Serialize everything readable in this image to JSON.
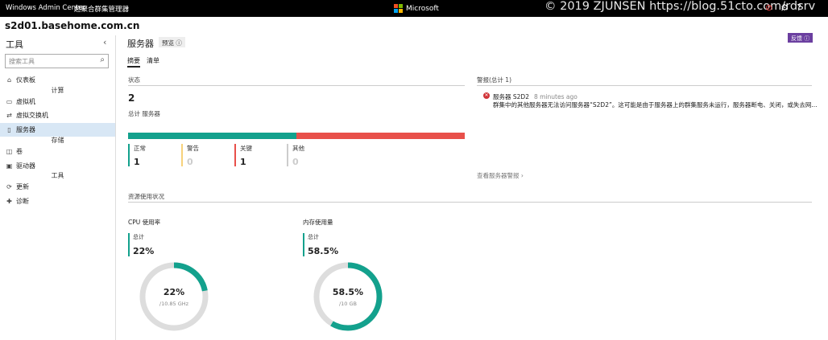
{
  "topbar": {
    "app_name": "Windows Admin Center",
    "context": "超聚合群集管理器",
    "brand": "Microsoft",
    "watermark": "© 2019 ZJUNSEN https://blog.51cto.com/rdsrv",
    "brand_colors": [
      "#f25022",
      "#7fba00",
      "#00a4ef",
      "#ffb900"
    ]
  },
  "host": "s2d01.basehome.com.cn",
  "sidebar": {
    "title": "工具",
    "search_placeholder": "搜索工具",
    "items": [
      {
        "label": "仪表板",
        "icon": "home-icon"
      },
      {
        "group": "计算"
      },
      {
        "label": "虚拟机",
        "icon": "vm-icon"
      },
      {
        "label": "虚拟交换机",
        "icon": "switch-icon"
      },
      {
        "label": "服务器",
        "icon": "server-icon",
        "active": true
      },
      {
        "group": "存储"
      },
      {
        "label": "卷",
        "icon": "volume-icon"
      },
      {
        "label": "驱动器",
        "icon": "drive-icon"
      },
      {
        "group": "工具"
      },
      {
        "label": "更新",
        "icon": "update-icon"
      },
      {
        "label": "诊断",
        "icon": "diagnose-icon"
      }
    ]
  },
  "main": {
    "title": "服务器",
    "preview_label": "预览",
    "feedback_label": "反馈",
    "tabs": [
      "摘要",
      "清单"
    ],
    "status": {
      "section_label": "状态",
      "total": "2",
      "total_label": "总计 服务器",
      "bar": {
        "healthy": 1,
        "critical": 1,
        "total": 2
      },
      "stats": [
        {
          "label": "正常",
          "value": "1",
          "color": "#13a18d"
        },
        {
          "label": "警告",
          "value": "0",
          "color": "#f7d27b"
        },
        {
          "label": "关键",
          "value": "1",
          "color": "#e8504a"
        },
        {
          "label": "其他",
          "value": "0",
          "color": "#cccccc"
        }
      ]
    },
    "alerts": {
      "section_label": "警报(总计 1)",
      "items": [
        {
          "title": "服务器 S2D2",
          "time": "8 minutes ago",
          "message": "群集中的其他服务器无法访问服务器“S2D2”。这可能是由于服务器上的群集服务未运行，服务器断电、关闭，或失去网..."
        }
      ],
      "view_all": "查看服务器警报"
    },
    "resources": {
      "section_label": "资源使用状况",
      "cpu": {
        "title": "CPU 使用率",
        "total_label": "总计",
        "value": "22%",
        "fraction": 0.22,
        "sub": "/10.85 GHz"
      },
      "memory": {
        "title": "内存使用量",
        "total_label": "总计",
        "value": "58.5%",
        "fraction": 0.585,
        "sub": "/10 GB"
      }
    }
  }
}
